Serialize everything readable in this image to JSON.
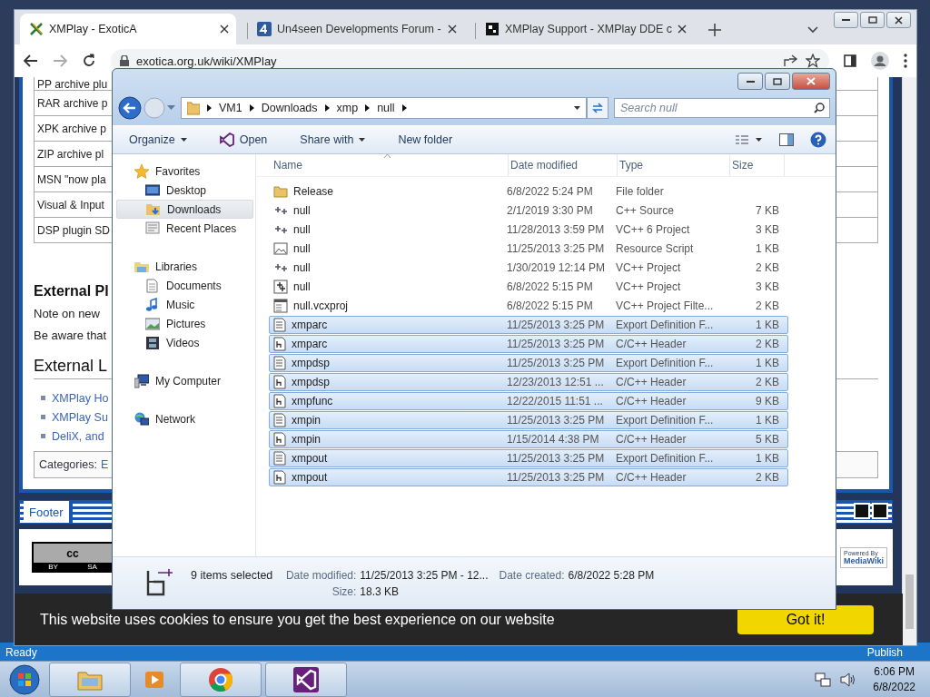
{
  "browser": {
    "tabs": [
      {
        "title": "XMPlay - ExoticA",
        "selected": true,
        "kind": "xmplay"
      },
      {
        "title": "Un4seen Developments Forum -",
        "selected": false,
        "kind": "forum"
      },
      {
        "title": "XMPlay Support - XMPlay DDE c",
        "selected": false,
        "kind": "puzzle"
      }
    ],
    "url": "exotica.org.uk/wiki/XMPlay",
    "page": {
      "table_rows": [
        "PP archive plu",
        "RAR archive p",
        "XPK archive p",
        "ZIP archive pl",
        "MSN \"now pla",
        "Visual & Input",
        "DSP plugin SD"
      ],
      "section_heading": "External Pl",
      "paragraphs": [
        "Note on new",
        "Be aware that"
      ],
      "links_heading": "External L",
      "links": [
        "XMPlay Ho",
        "XMPlay Su",
        "DeliX, and"
      ],
      "categories_label": "Categories:",
      "category": "E",
      "footer_label": "Footer",
      "license_badge": {
        "top": "cc",
        "bottom_left": "BY",
        "bottom_right": "SA"
      },
      "powered_badge": {
        "top": "Powered By",
        "bottom": "MediaWiki"
      }
    },
    "cookie_bar": {
      "message": "This website uses cookies to ensure you get the best experience on our website",
      "button": "Got it!"
    }
  },
  "explorer": {
    "breadcrumb": [
      "VM1",
      "Downloads",
      "xmp",
      "null"
    ],
    "search": {
      "placeholder": "Search null"
    },
    "toolbar": [
      {
        "label": "Organize",
        "kind": "menu"
      },
      {
        "label": "Open",
        "kind": "open"
      },
      {
        "label": "Share with",
        "kind": "menu"
      },
      {
        "label": "New folder",
        "kind": "plain"
      }
    ],
    "nav": [
      {
        "label": "Favorites",
        "kind": "star",
        "selected": false,
        "children": [
          {
            "label": "Desktop",
            "kind": "desktop",
            "selected": false
          },
          {
            "label": "Downloads",
            "kind": "downloads",
            "selected": true
          },
          {
            "label": "Recent Places",
            "kind": "recent",
            "selected": false
          }
        ]
      },
      {
        "label": "Libraries",
        "kind": "libraries",
        "selected": false,
        "children": [
          {
            "label": "Documents",
            "kind": "documents",
            "selected": false
          },
          {
            "label": "Music",
            "kind": "music",
            "selected": false
          },
          {
            "label": "Pictures",
            "kind": "pictures",
            "selected": false
          },
          {
            "label": "Videos",
            "kind": "videos",
            "selected": false
          }
        ]
      },
      {
        "label": "My Computer",
        "kind": "computer",
        "selected": false
      },
      {
        "label": "Network",
        "kind": "network",
        "selected": false
      }
    ],
    "columns": [
      "Name",
      "Date modified",
      "Type",
      "Size"
    ],
    "files": [
      {
        "name": "Release",
        "date": "6/8/2022 5:24 PM",
        "type": "File folder",
        "kind": "folder",
        "selected": false
      },
      {
        "name": "null",
        "date": "2/1/2019 3:30 PM",
        "type": "C++ Source",
        "size": "7 KB",
        "kind": "cpp",
        "selected": false
      },
      {
        "name": "null",
        "date": "11/28/2013 3:59 PM",
        "type": "VC++ 6 Project",
        "size": "3 KB",
        "kind": "cpp",
        "selected": false
      },
      {
        "name": "null",
        "date": "11/25/2013 3:25 PM",
        "type": "Resource Script",
        "size": "1 KB",
        "kind": "resource",
        "selected": false
      },
      {
        "name": "null",
        "date": "1/30/2019 12:14 PM",
        "type": "VC++ Project",
        "size": "2 KB",
        "kind": "cpp",
        "selected": false
      },
      {
        "name": "null",
        "date": "6/8/2022 5:15 PM",
        "type": "VC++ Project",
        "size": "3 KB",
        "kind": "project",
        "selected": false
      },
      {
        "name": "null.vcxproj",
        "date": "6/8/2022 5:15 PM",
        "type": "VC++ Project Filte...",
        "size": "2 KB",
        "kind": "filters",
        "selected": false
      },
      {
        "name": "xmparc",
        "date": "11/25/2013 3:25 PM",
        "type": "Export Definition F...",
        "size": "1 KB",
        "kind": "def",
        "selected": true
      },
      {
        "name": "xmparc",
        "date": "11/25/2013 3:25 PM",
        "type": "C/C++ Header",
        "size": "2 KB",
        "kind": "header",
        "selected": true
      },
      {
        "name": "xmpdsp",
        "date": "11/25/2013 3:25 PM",
        "type": "Export Definition F...",
        "size": "1 KB",
        "kind": "def",
        "selected": true
      },
      {
        "name": "xmpdsp",
        "date": "12/23/2013 12:51 ...",
        "type": "C/C++ Header",
        "size": "2 KB",
        "kind": "header",
        "selected": true
      },
      {
        "name": "xmpfunc",
        "date": "12/22/2015 11:51 ...",
        "type": "C/C++ Header",
        "size": "9 KB",
        "kind": "header",
        "selected": true
      },
      {
        "name": "xmpin",
        "date": "11/25/2013 3:25 PM",
        "type": "Export Definition F...",
        "size": "1 KB",
        "kind": "def",
        "selected": true
      },
      {
        "name": "xmpin",
        "date": "1/15/2014 4:38 PM",
        "type": "C/C++ Header",
        "size": "5 KB",
        "kind": "header",
        "selected": true
      },
      {
        "name": "xmpout",
        "date": "11/25/2013 3:25 PM",
        "type": "Export Definition F...",
        "size": "1 KB",
        "kind": "def",
        "selected": true
      },
      {
        "name": "xmpout",
        "date": "11/25/2013 3:25 PM",
        "type": "C/C++ Header",
        "size": "2 KB",
        "kind": "header",
        "selected": true
      }
    ],
    "details": {
      "summary": "9 items selected",
      "fields": [
        {
          "label": "Date modified:",
          "value": "11/25/2013 3:25 PM - 12..."
        },
        {
          "label": "Date created:",
          "value": "6/8/2022 5:28 PM"
        },
        {
          "label": "Size:",
          "value": "18.3 KB"
        }
      ]
    }
  },
  "ide_status": {
    "left": "Ready",
    "right": "Publish"
  },
  "taskbar": {
    "time": "6:06 PM",
    "date": "6/8/2022"
  }
}
